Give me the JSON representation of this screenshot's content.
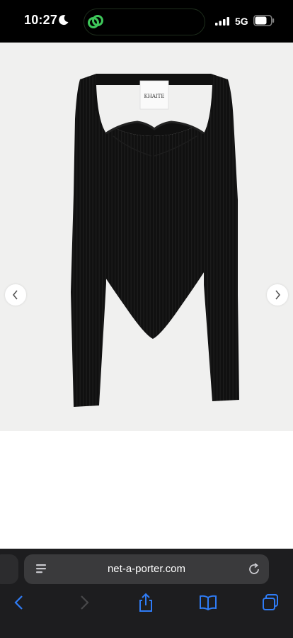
{
  "status_bar": {
    "time": "10:27",
    "network": "5G"
  },
  "product": {
    "label_text": "KHAITE",
    "garment_color": "#0f0f0f",
    "background": "#f0f0ef"
  },
  "browser": {
    "url": "net-a-porter.com"
  },
  "colors": {
    "accent": "#2f7cf6",
    "island_green": "#3ec75a"
  }
}
